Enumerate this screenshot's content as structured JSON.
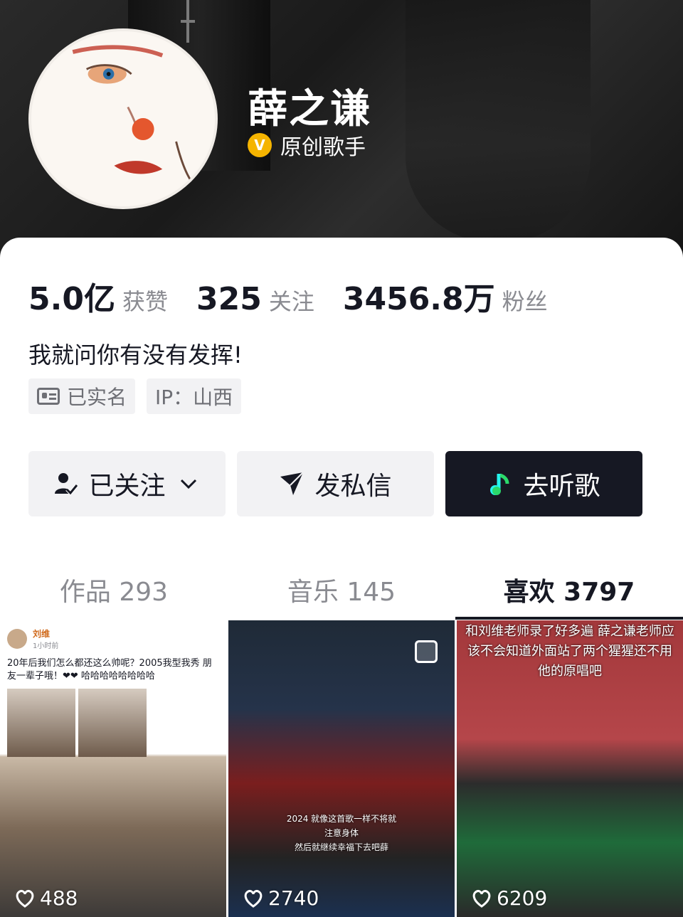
{
  "profile": {
    "nickname": "薛之谦",
    "verify_label": "原创歌手",
    "bio": "我就问你有没有发挥!",
    "tags": [
      "已实名",
      "IP：山西"
    ]
  },
  "stats": [
    {
      "value": "5.0亿",
      "label": "获赞"
    },
    {
      "value": "325",
      "label": "关注"
    },
    {
      "value": "3456.8万",
      "label": "粉丝"
    }
  ],
  "actions": {
    "following": "已关注",
    "message": "发私信",
    "listen": "去听歌"
  },
  "tabs": [
    {
      "label": "作品 293",
      "active": false
    },
    {
      "label": "音乐 145",
      "active": false
    },
    {
      "label": "喜欢 3797",
      "active": true
    }
  ],
  "grid": {
    "items": [
      {
        "likes": "488",
        "post_user": "刘维",
        "post_time": "1小时前",
        "post_text": "20年后我们怎么都还这么帅呢？2005我型我秀 朋友一辈子哦！❤❤ 哈哈哈哈哈哈哈哈"
      },
      {
        "likes": "2740",
        "caption_1": "2024 就像这首歌一样不将就",
        "caption_2": "注意身体",
        "caption_3": "然后就继续幸福下去吧薛"
      },
      {
        "likes": "6209",
        "caption": "和刘维老师录了好多遍 薛之谦老师应该不会知道外面站了两个猩猩还不用他的原唱吧"
      }
    ]
  }
}
